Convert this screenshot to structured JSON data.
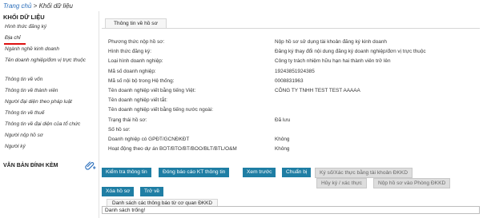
{
  "breadcrumb": {
    "home": "Trang chủ",
    "separator": ">",
    "current": "Khối dữ liệu"
  },
  "sidebar": {
    "title": "KHỐI DỮ LIỆU",
    "items": [
      {
        "label": "Hình thức đăng ký"
      },
      {
        "label": "Địa chỉ"
      },
      {
        "label": "Ngành nghề kinh doanh"
      },
      {
        "label": "Tên doanh nghiệp/đơn vị trực thuộc"
      },
      {
        "label": "Thông tin về vốn"
      },
      {
        "label": "Thông tin về thành viên"
      },
      {
        "label": "Người đại diện theo pháp luật"
      },
      {
        "label": "Thông tin về thuế"
      },
      {
        "label": "Thông tin về đại diện của tổ chức"
      },
      {
        "label": "Người nộp hồ sơ"
      },
      {
        "label": "Người ký"
      }
    ],
    "section2": "VĂN BẢN ĐÍNH KÈM",
    "attach_icon": "paperclip-icon"
  },
  "main": {
    "tab": "Thông tin về hồ sơ",
    "rows": [
      {
        "label": "Phương thức nộp hồ sơ:",
        "value": "Nộp hồ sơ sử dụng tài khoản đăng ký kinh doanh"
      },
      {
        "label": "Hình thức đăng ký:",
        "value": "Đăng ký thay đổi nội dung đăng ký doanh nghiệp/đơn vị trực thuộc"
      },
      {
        "label": "Loại hình doanh nghiệp:",
        "value": "Công ty trách nhiệm hữu hạn hai thành viên trở lên"
      },
      {
        "label": "Mã số doanh nghiệp:",
        "value": "19243851924385"
      },
      {
        "label": "Mã số nội bộ trong Hệ thống:",
        "value": "0008831963"
      },
      {
        "label": "Tên doanh nghiệp viết bằng tiếng Việt:",
        "value": "CÔNG TY TNHH TEST TEST AAAAA"
      },
      {
        "label": "Tên doanh nghiệp viết tắt:",
        "value": ""
      },
      {
        "label": "Tên doanh nghiệp viết bằng tiếng nước ngoài:",
        "value": ""
      },
      {
        "label": "Trạng thái hồ sơ:",
        "value": "Đã lưu"
      },
      {
        "label": "Số hồ sơ:",
        "value": ""
      },
      {
        "label": "Doanh nghiệp có GPĐT/GCNĐKĐT",
        "value": "Không"
      },
      {
        "label": "Hoạt động theo dự án BOT/BTO/BT/BOO/BLT/BTL/O&M",
        "value": "Không"
      }
    ]
  },
  "buttons": {
    "check_info": "Kiểm tra thông tin",
    "report_errors": "Đóng báo cáo KT thông tin",
    "preview": "Xem trước",
    "prepare": "Chuẩn bị",
    "sign_verify": "Ký số/Xác thực bằng tài khoản ĐKKD",
    "cancel_sign": "Hủy ký / xác thực",
    "submit": "Nộp hồ sơ vào Phòng ĐKKD",
    "delete": "Xóa hồ sơ",
    "back": "Trở về"
  },
  "notifications": {
    "tab": "Danh sách các thông báo từ cơ quan ĐKKD",
    "empty": "Danh sách trống!"
  },
  "colors": {
    "button": "#1f7ea4",
    "link": "#2a6ebb",
    "active_underline": "#dd1111"
  }
}
